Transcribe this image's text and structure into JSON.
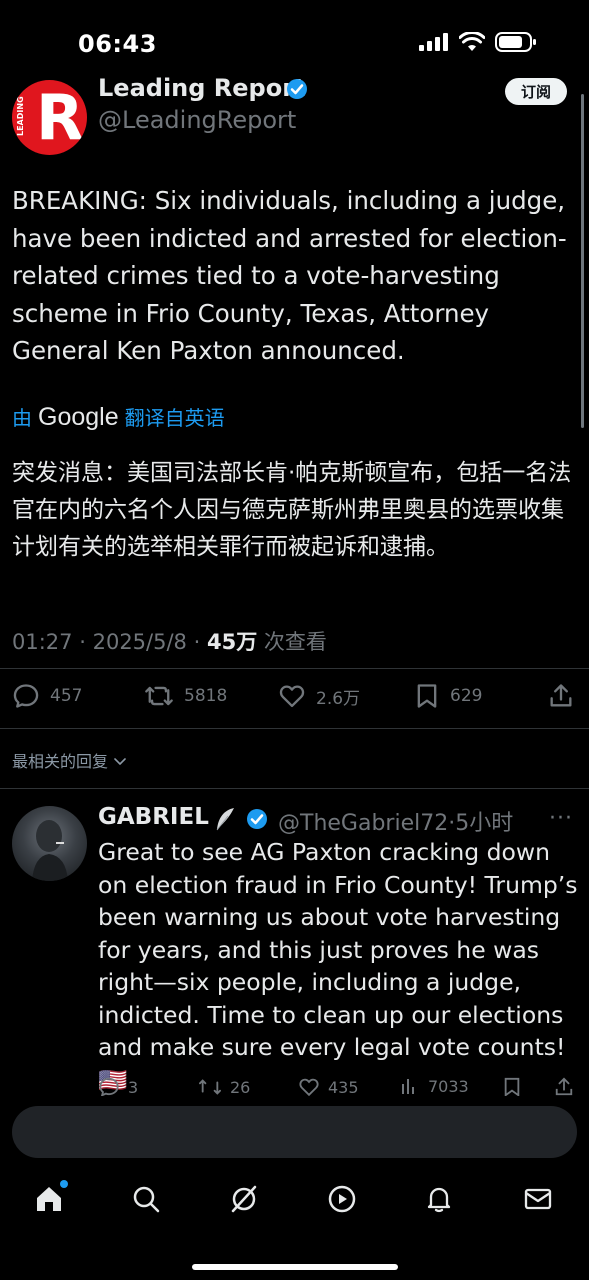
{
  "status_bar": {
    "time": "06:43"
  },
  "tweet": {
    "author": {
      "display_name": "Leading Report",
      "handle": "@LeadingReport",
      "avatar_letter": "R",
      "avatar_side_text": "LEADING"
    },
    "subscribe_label": "订阅",
    "text": "BREAKING: Six individuals, including a judge, have been indicted and arrested for election-related crimes tied to a vote-harvesting scheme in Frio County, Texas, Attorney General Ken Paxton announced.",
    "translated_prefix": "由",
    "translated_brand": "Google",
    "translated_suffix": "翻译自英语",
    "translation": "突发消息：美国司法部长肯·帕克斯顿宣布，包括一名法官在内的六名个人因与德克萨斯州弗里奥县的选票收集计划有关的选举相关罪行而被起诉和逮捕。",
    "time": "01:27",
    "date": "2025/5/8",
    "views_count": "45万",
    "views_label": "次查看",
    "stats": {
      "replies": "457",
      "reposts": "5818",
      "likes": "2.6万",
      "bookmarks": "629"
    }
  },
  "replies_sort_label": "最相关的回复",
  "reply": {
    "display_name": "GABRIEL",
    "handle_and_time": "@TheGabriel72·5小时",
    "more": "···",
    "text": "Great to see AG Paxton cracking down on election fraud in Frio County! Trump’s been warning us about vote harvesting for years, and this just proves he was right—six people, including a judge, indicted. Time to clean up our elections and make sure every legal vote counts! 🇺🇸",
    "stats": {
      "replies": "3",
      "reposts": "26",
      "likes": "435",
      "views": "7033"
    }
  },
  "compose": {
    "placeholder": ""
  },
  "colors": {
    "accent": "#1d9bf0",
    "text": "#e7e9ea",
    "muted": "#71767b",
    "brand_red": "#e0161e"
  },
  "icons": {
    "status": [
      "signal-icon",
      "wifi-icon",
      "battery-icon"
    ],
    "actions": [
      "reply-icon",
      "repost-icon",
      "like-icon",
      "bookmark-icon",
      "share-icon"
    ],
    "tabs": [
      "home-icon",
      "search-icon",
      "grok-icon",
      "video-icon",
      "notifications-icon",
      "messages-icon"
    ]
  }
}
